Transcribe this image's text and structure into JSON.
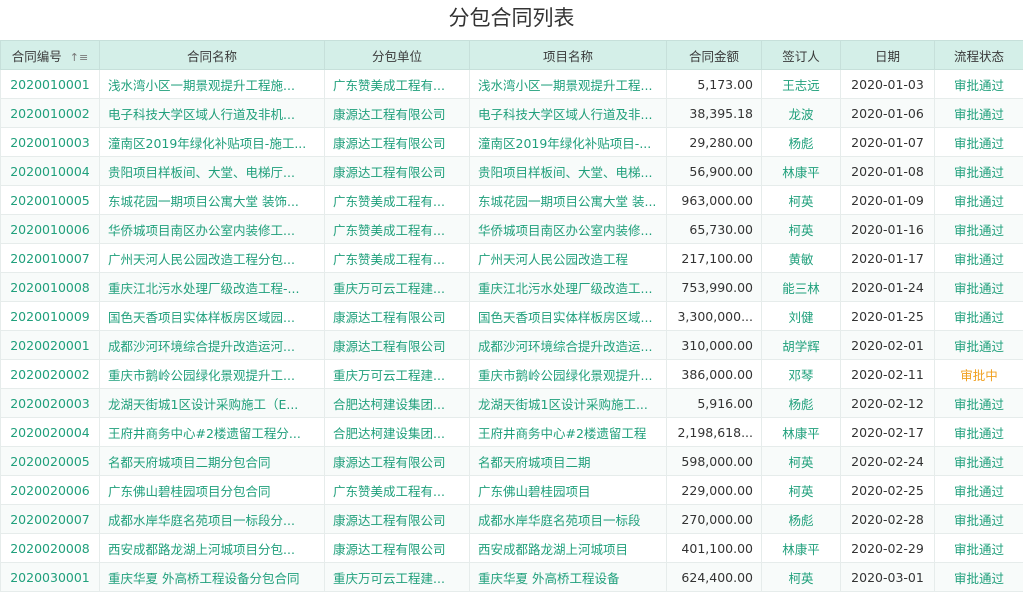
{
  "title": "分包合同列表",
  "columns": [
    "合同编号",
    "合同名称",
    "分包单位",
    "项目名称",
    "合同金额",
    "签订人",
    "日期",
    "流程状态"
  ],
  "sort_icon": "sort-icon",
  "colors": {
    "accent": "#20a07c",
    "header_bg": "#d4efe8",
    "status_pending": "#f0a020"
  },
  "rows": [
    {
      "id": "2020010001",
      "name": "浅水湾小区一期景观提升工程施...",
      "unit": "广东赞美成工程有...",
      "project": "浅水湾小区一期景观提升工程...",
      "amount": "5,173.00",
      "signer": "王志远",
      "date": "2020-01-03",
      "status": "审批通过"
    },
    {
      "id": "2020010002",
      "name": "电子科技大学区域人行道及非机...",
      "unit": "康源达工程有限公司",
      "project": "电子科技大学区域人行道及非...",
      "amount": "38,395.18",
      "signer": "龙波",
      "date": "2020-01-06",
      "status": "审批通过"
    },
    {
      "id": "2020010003",
      "name": "潼南区2019年绿化补贴项目-施工...",
      "unit": "康源达工程有限公司",
      "project": "潼南区2019年绿化补贴项目-...",
      "amount": "29,280.00",
      "signer": "杨彪",
      "date": "2020-01-07",
      "status": "审批通过"
    },
    {
      "id": "2020010004",
      "name": "贵阳项目样板间、大堂、电梯厅...",
      "unit": "康源达工程有限公司",
      "project": "贵阳项目样板间、大堂、电梯...",
      "amount": "56,900.00",
      "signer": "林康平",
      "date": "2020-01-08",
      "status": "审批通过"
    },
    {
      "id": "2020010005",
      "name": "东城花园一期项目公寓大堂 装饰...",
      "unit": "广东赞美成工程有...",
      "project": "东城花园一期项目公寓大堂 装...",
      "amount": "963,000.00",
      "signer": "柯英",
      "date": "2020-01-09",
      "status": "审批通过"
    },
    {
      "id": "2020010006",
      "name": "华侨城项目南区办公室内装修工...",
      "unit": "广东赞美成工程有...",
      "project": "华侨城项目南区办公室内装修...",
      "amount": "65,730.00",
      "signer": "柯英",
      "date": "2020-01-16",
      "status": "审批通过"
    },
    {
      "id": "2020010007",
      "name": "广州天河人民公园改造工程分包...",
      "unit": "广东赞美成工程有...",
      "project": "广州天河人民公园改造工程",
      "amount": "217,100.00",
      "signer": "黄敏",
      "date": "2020-01-17",
      "status": "审批通过"
    },
    {
      "id": "2020010008",
      "name": "重庆江北污水处理厂级改造工程-...",
      "unit": "重庆万可云工程建...",
      "project": "重庆江北污水处理厂级改造工...",
      "amount": "753,990.00",
      "signer": "能三林",
      "date": "2020-01-24",
      "status": "审批通过"
    },
    {
      "id": "2020010009",
      "name": "国色天香项目实体样板房区域园...",
      "unit": "康源达工程有限公司",
      "project": "国色天香项目实体样板房区域...",
      "amount": "3,300,000...",
      "signer": "刘健",
      "date": "2020-01-25",
      "status": "审批通过"
    },
    {
      "id": "2020020001",
      "name": "成都沙河环境综合提升改造运河...",
      "unit": "康源达工程有限公司",
      "project": "成都沙河环境综合提升改造运...",
      "amount": "310,000.00",
      "signer": "胡学辉",
      "date": "2020-02-01",
      "status": "审批通过"
    },
    {
      "id": "2020020002",
      "name": "重庆市鹅岭公园绿化景观提升工...",
      "unit": "重庆万可云工程建...",
      "project": "重庆市鹅岭公园绿化景观提升...",
      "amount": "386,000.00",
      "signer": "邓琴",
      "date": "2020-02-11",
      "status": "审批中"
    },
    {
      "id": "2020020003",
      "name": "龙湖天街城1区设计采购施工（E...",
      "unit": "合肥达柯建设集团...",
      "project": "龙湖天街城1区设计采购施工...",
      "amount": "5,916.00",
      "signer": "杨彪",
      "date": "2020-02-12",
      "status": "审批通过"
    },
    {
      "id": "2020020004",
      "name": "王府井商务中心#2楼遗留工程分...",
      "unit": "合肥达柯建设集团...",
      "project": "王府井商务中心#2楼遗留工程",
      "amount": "2,198,618...",
      "signer": "林康平",
      "date": "2020-02-17",
      "status": "审批通过"
    },
    {
      "id": "2020020005",
      "name": "名都天府城项目二期分包合同",
      "unit": "康源达工程有限公司",
      "project": "名都天府城项目二期",
      "amount": "598,000.00",
      "signer": "柯英",
      "date": "2020-02-24",
      "status": "审批通过"
    },
    {
      "id": "2020020006",
      "name": "广东佛山碧桂园项目分包合同",
      "unit": "广东赞美成工程有...",
      "project": "广东佛山碧桂园项目",
      "amount": "229,000.00",
      "signer": "柯英",
      "date": "2020-02-25",
      "status": "审批通过"
    },
    {
      "id": "2020020007",
      "name": "成都水岸华庭名苑项目一标段分...",
      "unit": "康源达工程有限公司",
      "project": "成都水岸华庭名苑项目一标段",
      "amount": "270,000.00",
      "signer": "杨彪",
      "date": "2020-02-28",
      "status": "审批通过"
    },
    {
      "id": "2020020008",
      "name": "西安成都路龙湖上河城项目分包...",
      "unit": "康源达工程有限公司",
      "project": "西安成都路龙湖上河城项目",
      "amount": "401,100.00",
      "signer": "林康平",
      "date": "2020-02-29",
      "status": "审批通过"
    },
    {
      "id": "2020030001",
      "name": "重庆华夏 外高桥工程设备分包合同",
      "unit": "重庆万可云工程建...",
      "project": "重庆华夏 外高桥工程设备",
      "amount": "624,400.00",
      "signer": "柯英",
      "date": "2020-03-01",
      "status": "审批通过"
    }
  ]
}
